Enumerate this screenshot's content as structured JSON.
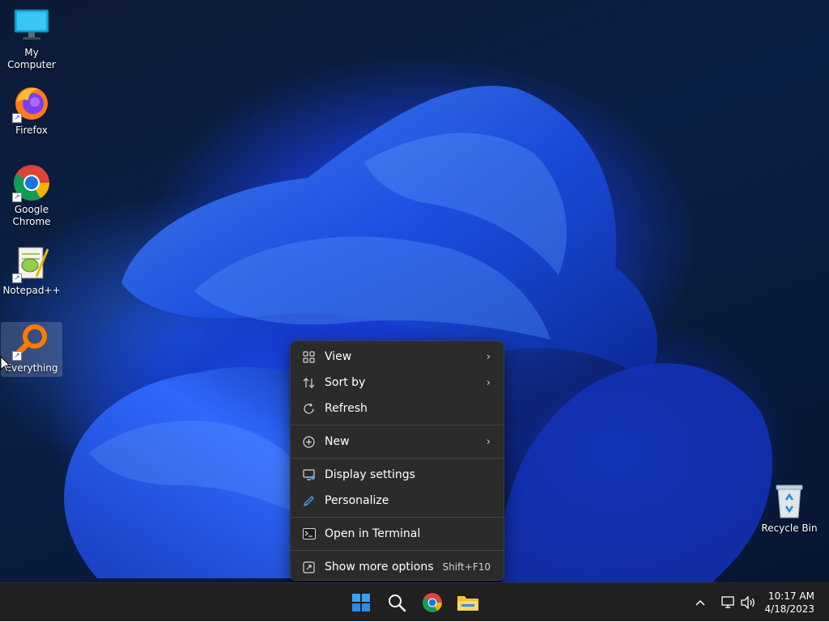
{
  "desktop": {
    "icons": [
      {
        "label": "My Computer",
        "icon": "monitor-icon"
      },
      {
        "label": "Firefox",
        "icon": "firefox-icon"
      },
      {
        "label": "Google Chrome",
        "icon": "chrome-icon"
      },
      {
        "label": "Notepad++",
        "icon": "notepadpp-icon"
      },
      {
        "label": "Everything",
        "icon": "everything-search-icon"
      },
      {
        "label": "Recycle Bin",
        "icon": "recycle-bin-icon"
      }
    ]
  },
  "context_menu": {
    "items": [
      {
        "label": "View",
        "icon": "grid-icon",
        "submenu": true
      },
      {
        "label": "Sort by",
        "icon": "sort-icon",
        "submenu": true
      },
      {
        "label": "Refresh",
        "icon": "refresh-icon",
        "submenu": false
      },
      {
        "label": "New",
        "icon": "plus-circle-icon",
        "submenu": true
      },
      {
        "label": "Display settings",
        "icon": "display-icon",
        "submenu": false
      },
      {
        "label": "Personalize",
        "icon": "pen-icon",
        "submenu": false
      },
      {
        "label": "Open in Terminal",
        "icon": "terminal-icon",
        "submenu": false
      },
      {
        "label": "Show more options",
        "icon": "expand-icon",
        "shortcut": "Shift+F10"
      }
    ],
    "chevron": "›"
  },
  "taskbar": {
    "apps": [
      "start-icon",
      "search-icon",
      "chrome-icon",
      "file-explorer-icon"
    ],
    "tray": {
      "overflow_glyph": "^",
      "time": "10:17 AM",
      "date": "4/18/2023"
    }
  },
  "colors": {
    "accent": "#1e6cff",
    "menu_bg": "#2b2b2b",
    "taskbar_bg": "#202020"
  }
}
